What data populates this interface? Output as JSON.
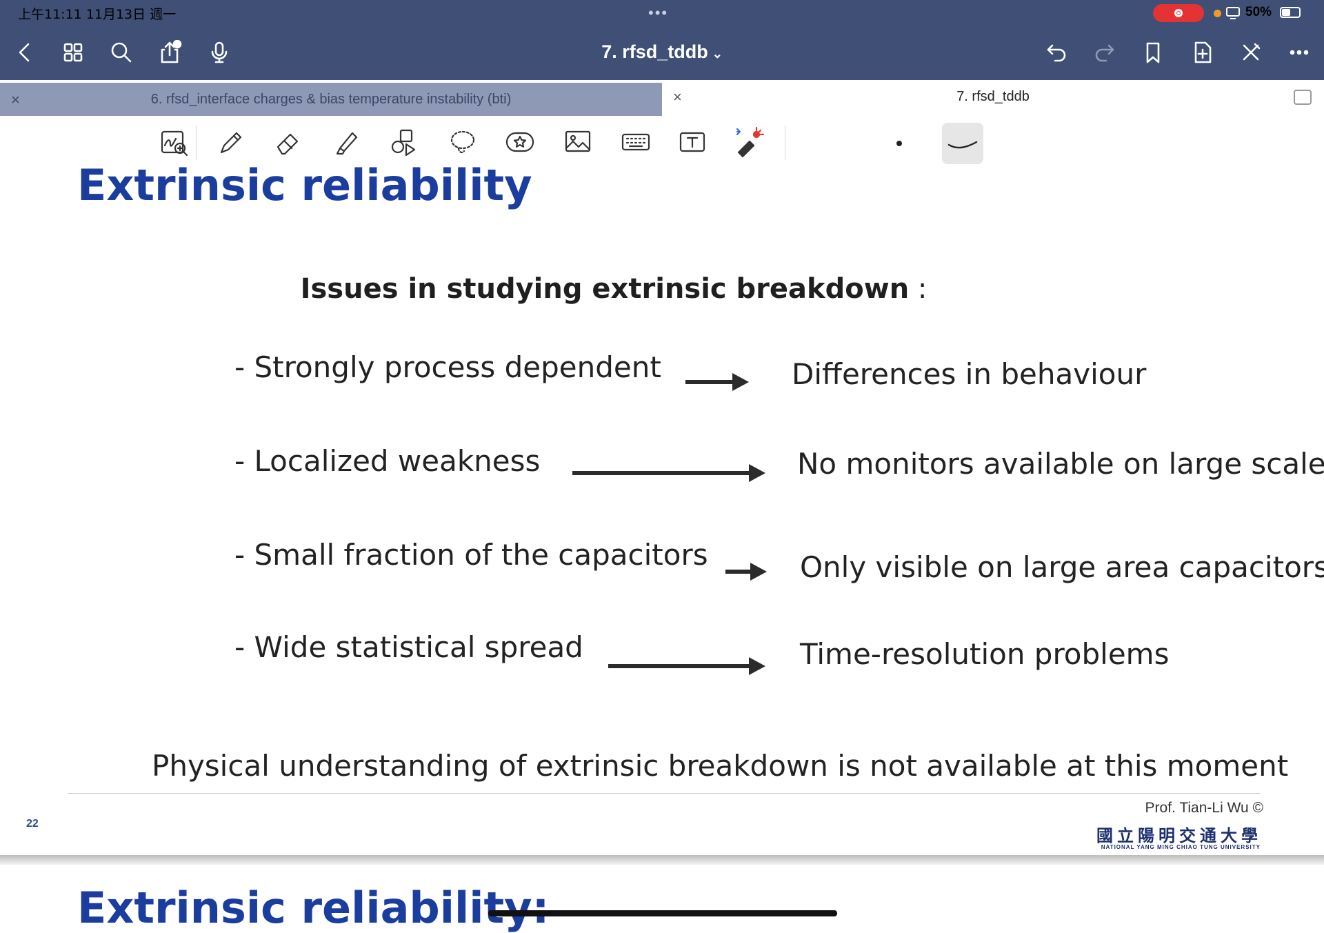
{
  "status_bar": {
    "time": "上午11:11   11月13日 週一",
    "more": "•••",
    "battery_pct": "50%",
    "battery_level": 0.5
  },
  "nav": {
    "doc_title": "7. rfsd_tddb",
    "chevron": "⌄",
    "icons": [
      "back-icon",
      "thumbnails-icon",
      "search-icon",
      "share-icon",
      "microphone-icon",
      "undo-icon",
      "redo-icon",
      "bookmark-icon",
      "add-page-icon",
      "close-edit-icon",
      "more-icon"
    ]
  },
  "tabs": [
    {
      "label": "6. rfsd_interface charges & bias temperature instability (bti)",
      "active": false,
      "close": "×"
    },
    {
      "label": "7. rfsd_tddb",
      "active": true,
      "close": "×"
    }
  ],
  "toolbar": {
    "tools": [
      "zoom-handwriting-icon",
      "pen-icon",
      "eraser-icon",
      "highlighter-icon",
      "shapes-icon",
      "lasso-icon",
      "sticker-icon",
      "image-icon",
      "keyboard-icon",
      "textbox-icon",
      "laser-pointer-icon"
    ],
    "colors": {
      "bluetooth": "#2f6fe0",
      "laser": "#e53235"
    }
  },
  "slide": {
    "title": "Extrinsic reliability",
    "subheading": "Issues in studying extrinsic breakdown",
    "subheading_suffix": " :",
    "rows": [
      {
        "issue": "- Strongly process dependent",
        "result": "Differences in behaviour"
      },
      {
        "issue": "- Localized weakness",
        "result": "No monitors available on large scale"
      },
      {
        "issue": "- Small fraction of the capacitors",
        "result": "Only visible on large  area capacitors"
      },
      {
        "issue": "- Wide statistical spread",
        "result": "Time-resolution  problems"
      }
    ],
    "conclusion": "Physical understanding of extrinsic breakdown is not available at this moment",
    "page_number": "22",
    "credit": "Prof. Tian-Li Wu ©",
    "university": "國立陽明交通大學",
    "university_en": "NATIONAL YANG MING CHIAO TUNG UNIVERSITY",
    "title_color": "#1a3d9e"
  },
  "next_slide": {
    "title": "Extrinsic reliability:"
  }
}
